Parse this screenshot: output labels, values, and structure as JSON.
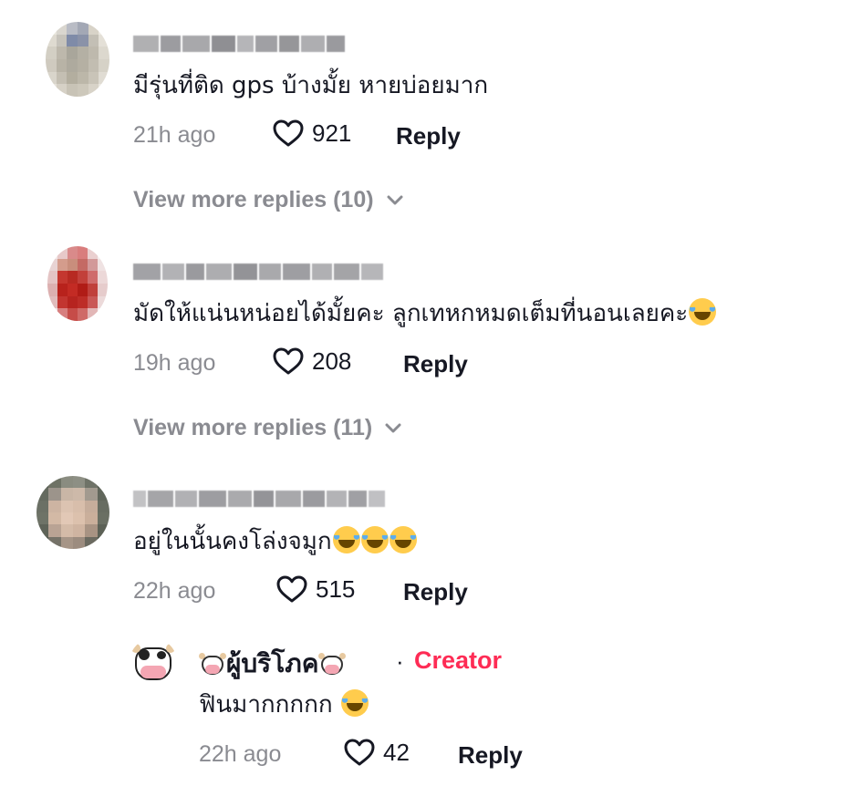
{
  "comments": [
    {
      "text": "มีรุ่นที่ติด gps บ้างมั้ย หายบ่อยมาก",
      "time": "21h ago",
      "likes": "921",
      "reply_label": "Reply",
      "view_more": "View more replies (10)"
    },
    {
      "text": "มัดให้แน่นหน่อยได้มั้ยคะ ลูกเทหกหมดเต็มที่นอนเลยคะ",
      "time": "19h ago",
      "likes": "208",
      "reply_label": "Reply",
      "view_more": "View more replies (11)"
    },
    {
      "text": "อยู่ในนั้นคงโล่งจมูก",
      "time": "22h ago",
      "likes": "515",
      "reply_label": "Reply"
    }
  ],
  "creator_reply": {
    "name": "ผู้บริโภค",
    "separator": "·",
    "badge": "Creator",
    "text": "ฟินมากกกกก",
    "time": "22h ago",
    "likes": "42",
    "reply_label": "Reply"
  },
  "colors": {
    "creator_badge": "#fe2c55",
    "meta_gray": "#8a8b91",
    "text": "#161823"
  },
  "icons": [
    "heart-icon",
    "chevron-down-icon",
    "tears-of-joy-emoji",
    "cow-emoji"
  ]
}
